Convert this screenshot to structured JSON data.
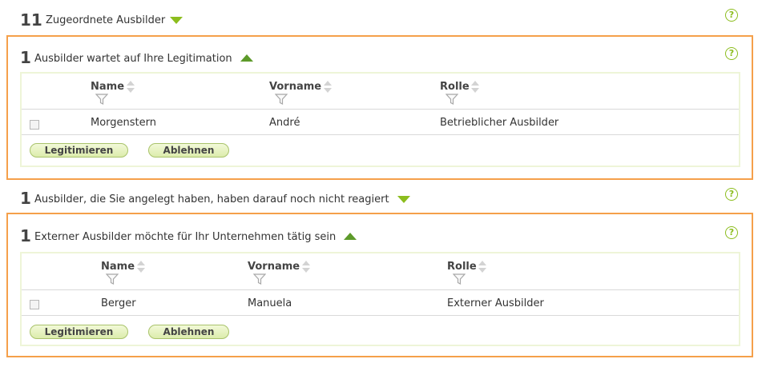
{
  "sections": [
    {
      "count": "11",
      "label": "Zugeordnete Ausbilder"
    },
    {
      "count": "1",
      "label": "Ausbilder wartet auf Ihre Legitimation",
      "columns": [
        "Name",
        "Vorname",
        "Rolle"
      ],
      "rows": [
        {
          "name": "Morgenstern",
          "vorname": "André",
          "rolle": "Betrieblicher Ausbilder"
        }
      ],
      "buttons": [
        "Legitimieren",
        "Ablehnen"
      ]
    },
    {
      "count": "1",
      "label": "Ausbilder, die Sie angelegt haben, haben darauf noch nicht reagiert"
    },
    {
      "count": "1",
      "label": "Externer Ausbilder möchte für Ihr Unternehmen tätig sein",
      "columns": [
        "Name",
        "Vorname",
        "Rolle"
      ],
      "rows": [
        {
          "name": "Berger",
          "vorname": "Manuela",
          "rolle": "Externer Ausbilder"
        }
      ],
      "buttons": [
        "Legitimieren",
        "Ablehnen"
      ]
    }
  ],
  "icons": {
    "help": "?",
    "collapsed": "triangle-down-icon",
    "expanded": "triangle-up-icon"
  },
  "colors": {
    "accent_green": "#8cbd1e",
    "dark_green": "#5d9a2a",
    "panel_border": "#f5a04a"
  }
}
